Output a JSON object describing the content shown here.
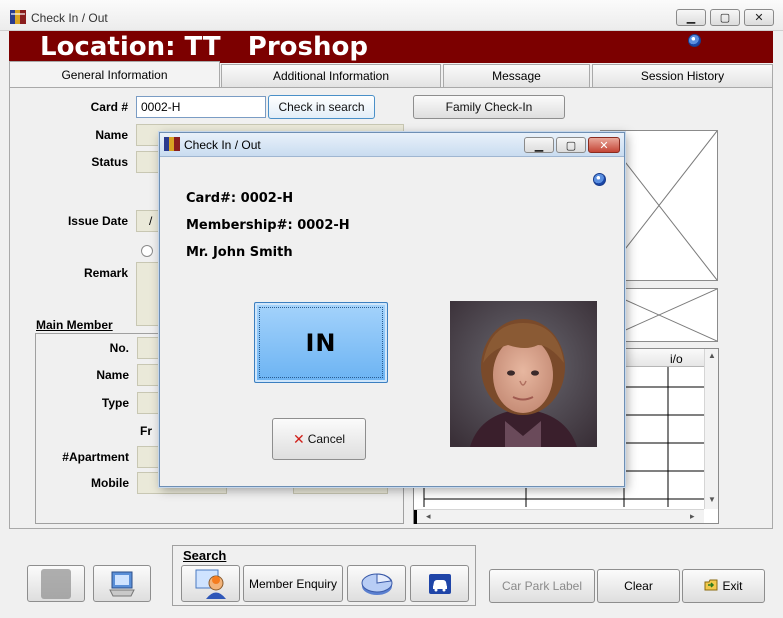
{
  "window": {
    "title": "Check In / Out"
  },
  "banner": {
    "location": "Location: TT   Proshop"
  },
  "tabs": [
    {
      "label": "General Information",
      "active": true
    },
    {
      "label": "Additional Information",
      "active": false
    },
    {
      "label": "Message",
      "active": false
    },
    {
      "label": "Session History",
      "active": false
    }
  ],
  "form": {
    "card_label": "Card #",
    "card_value": "0002-H",
    "check_in_search": "Check in search",
    "family_check_in": "Family Check-In",
    "name_label": "Name",
    "status_label": "Status",
    "issue_date_label": "Issue Date",
    "issue_date_value": "/",
    "remark_label": "Remark"
  },
  "main_member": {
    "title": "Main Member",
    "no_label": "No.",
    "name_label": "Name",
    "type_label": "Type",
    "fr_label": "Fr",
    "apartment_label": "Apartment#",
    "mobile_label": "Mobile"
  },
  "grid": {
    "io_header": "i/o"
  },
  "dialog": {
    "title": "Check In / Out",
    "card_line": "Card#: 0002-H",
    "membership_line": "Membership#: 0002-H",
    "name_line": "Mr. John Smith",
    "in_button": "IN",
    "cancel_button": "Cancel"
  },
  "bottom": {
    "search_title": "Search",
    "member_enquiry": "Member Enquiry",
    "car_park_label": "Car Park Label",
    "clear": "Clear",
    "exit": "Exit"
  },
  "colors": {
    "banner": "#7c0000",
    "in_button": "#7fbdf5",
    "field": "#eae9d9"
  }
}
